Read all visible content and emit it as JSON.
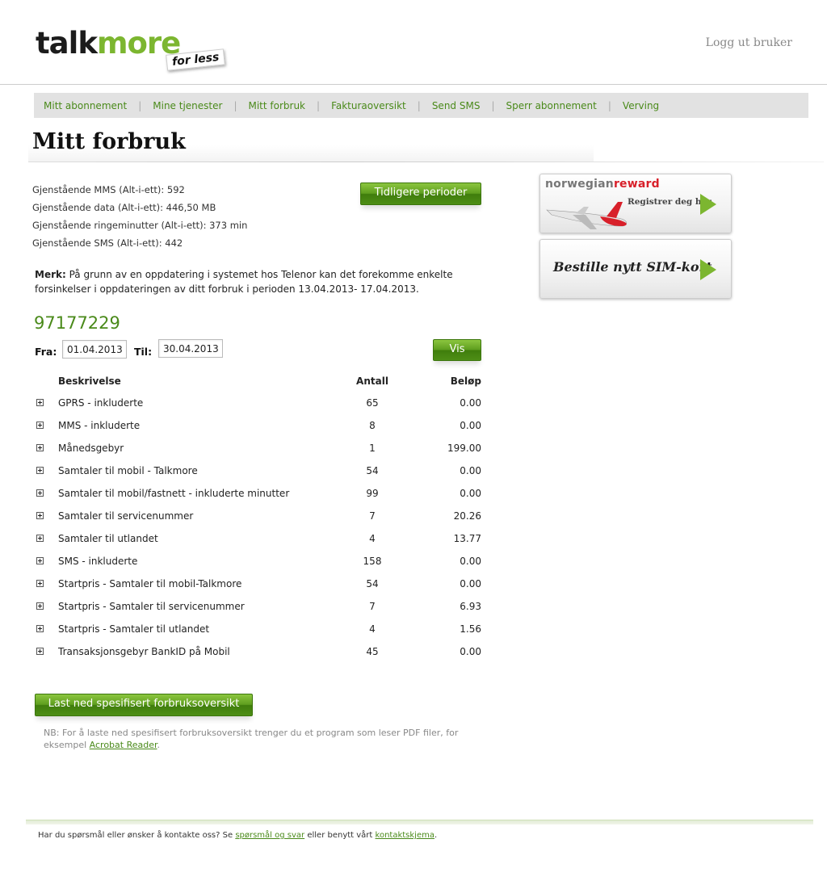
{
  "header": {
    "logo_talk": "talk",
    "logo_more": "more",
    "logo_tagline": "for less",
    "logout": "Logg ut bruker"
  },
  "nav": {
    "items": [
      "Mitt abonnement",
      "Mine tjenester",
      "Mitt forbruk",
      "Fakturaoversikt",
      "Send SMS",
      "Sperr abonnement",
      "Verving"
    ]
  },
  "page_title": "Mitt forbruk",
  "remaining": [
    "Gjenstående MMS (Alt-i-ett): 592",
    "Gjenstående data (Alt-i-ett): 446,50 MB",
    "Gjenstående ringeminutter (Alt-i-ett): 373 min",
    "Gjenstående SMS (Alt-i-ett): 442"
  ],
  "previous_button": "Tidligere perioder",
  "note": {
    "label": "Merk:",
    "text": " På grunn av en oppdatering i systemet hos Telenor kan det forekomme enkelte forsinkelser i oppdateringen av ditt forbruk i perioden 13.04.2013- 17.04.2013."
  },
  "phone_number": "97177229",
  "filter": {
    "from_label": "Fra:",
    "from_value": "01.04.2013",
    "to_label": "Til:",
    "to_value": "30.04.2013",
    "show_button": "Vis"
  },
  "table": {
    "headers": [
      "Beskrivelse",
      "Antall",
      "Beløp"
    ],
    "rows": [
      {
        "desc": "GPRS - inkluderte",
        "count": "65",
        "amount": "0.00"
      },
      {
        "desc": "MMS - inkluderte",
        "count": "8",
        "amount": "0.00"
      },
      {
        "desc": "Månedsgebyr",
        "count": "1",
        "amount": "199.00"
      },
      {
        "desc": "Samtaler til mobil - Talkmore",
        "count": "54",
        "amount": "0.00"
      },
      {
        "desc": "Samtaler til mobil/fastnett - inkluderte minutter",
        "count": "99",
        "amount": "0.00"
      },
      {
        "desc": "Samtaler til servicenummer",
        "count": "7",
        "amount": "20.26"
      },
      {
        "desc": "Samtaler til utlandet",
        "count": "4",
        "amount": "13.77"
      },
      {
        "desc": "SMS - inkluderte",
        "count": "158",
        "amount": "0.00"
      },
      {
        "desc": "Startpris - Samtaler til mobil-Talkmore",
        "count": "54",
        "amount": "0.00"
      },
      {
        "desc": "Startpris - Samtaler til servicenummer",
        "count": "7",
        "amount": "6.93"
      },
      {
        "desc": "Startpris - Samtaler til utlandet",
        "count": "4",
        "amount": "1.56"
      },
      {
        "desc": "Transaksjonsgebyr BankID på Mobil",
        "count": "45",
        "amount": "0.00"
      }
    ]
  },
  "download": {
    "button": "Last ned spesifisert forbruksoversikt",
    "note_prefix": "NB: For å laste ned spesifisert forbruksoversikt trenger du et program som leser PDF filer, for eksempel ",
    "note_link": "Acrobat Reader",
    "note_suffix": "."
  },
  "promos": {
    "norwegian_logo_a": "norwegian",
    "norwegian_logo_b": "reward",
    "norwegian_cta": "Registrer deg her",
    "sim_cta": "Bestille nytt SIM-kort"
  },
  "footer": {
    "prefix": "Har du spørsmål eller ønsker å kontakte oss? Se ",
    "link1": "spørsmål og svar",
    "middle": " eller benytt vårt ",
    "link2": "kontaktskjema",
    "suffix": "."
  },
  "colors": {
    "brand_green": "#7cb630",
    "link_green": "#4a8a1a",
    "nav_bg": "#e2e2e2",
    "norwegian_red": "#d8202a"
  }
}
